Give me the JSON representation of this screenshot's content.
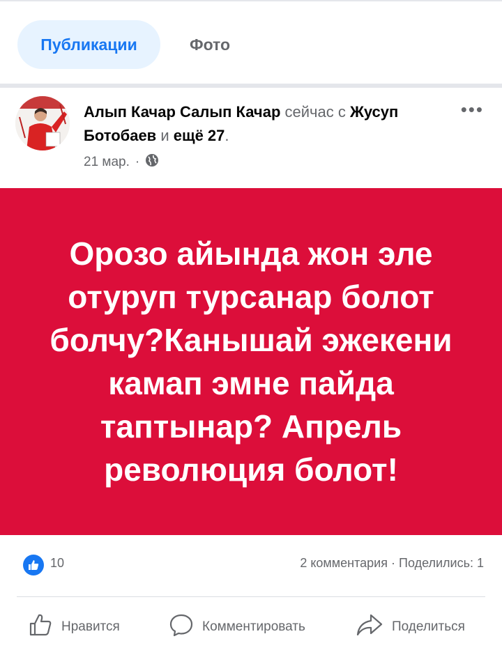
{
  "tabs": {
    "active_label": "Публикации",
    "photo_label": "Фото"
  },
  "post": {
    "author": "Алып Качар Салып Качар",
    "with_text": "сейчас с",
    "tagged_person": "Жусуп Ботобаев",
    "and_text": "и",
    "others": "ещё 27",
    "period": ".",
    "date": "21 мар.",
    "date_separator": "·",
    "privacy_icon": "globe-icon",
    "more_icon": "more-options-icon",
    "more_label": "•••",
    "banner_text": "Орозо айында жон эле отуруп турсанар болот болчу?Канышай эжекени камап эмне пайда таптынар? Апрель революция болот!",
    "banner_color": "#dc0e3a"
  },
  "stats": {
    "likes": "10",
    "comments": "2 комментария",
    "separator": "·",
    "shares": "Поделились: 1"
  },
  "actions": {
    "like_label": "Нравится",
    "comment_label": "Комментировать",
    "share_label": "Поделиться"
  },
  "colors": {
    "accent": "#1877f2",
    "muted": "#65676b"
  }
}
